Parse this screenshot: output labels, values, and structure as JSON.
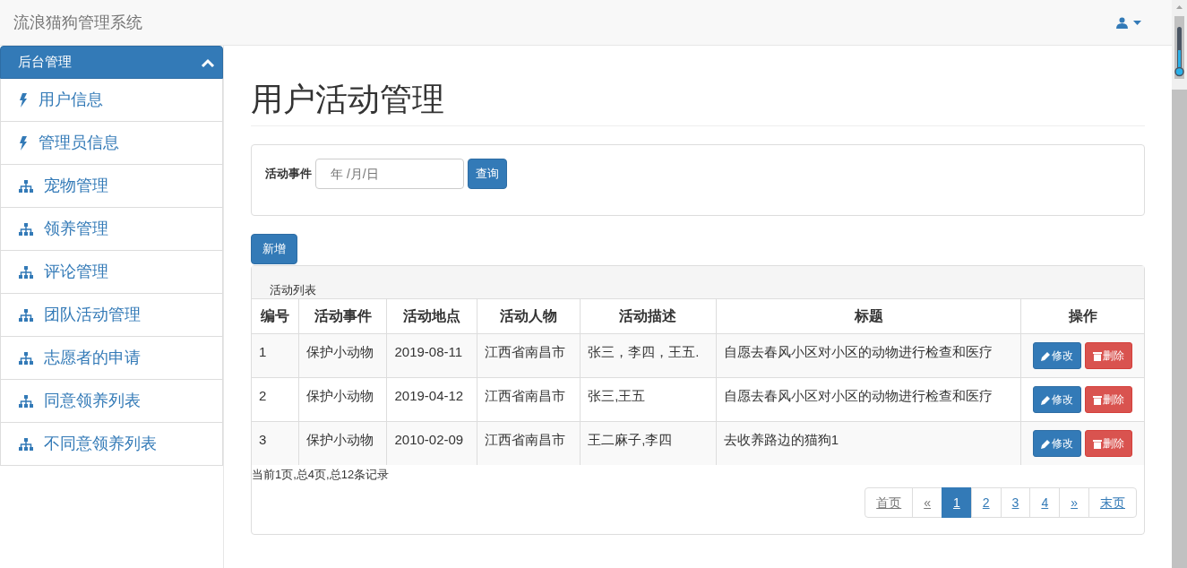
{
  "navbar": {
    "brand": "流浪猫狗管理系统"
  },
  "sidebar": {
    "title": "后台管理",
    "expanded": true,
    "items": [
      {
        "label": "用户信息",
        "kind": "bolt"
      },
      {
        "label": "管理员信息",
        "kind": "bolt"
      },
      {
        "label": "宠物管理",
        "kind": "tree"
      },
      {
        "label": "领养管理",
        "kind": "tree"
      },
      {
        "label": "评论管理",
        "kind": "tree"
      },
      {
        "label": "团队活动管理",
        "kind": "tree"
      },
      {
        "label": "志愿者的申请",
        "kind": "tree"
      },
      {
        "label": "同意领养列表",
        "kind": "tree"
      },
      {
        "label": "不同意领养列表",
        "kind": "tree"
      }
    ]
  },
  "page_title": "用户活动管理",
  "search": {
    "label": "活动事件",
    "placeholder": "年 /月/日",
    "button": "查询"
  },
  "add_button": "新增",
  "table": {
    "caption": "活动列表",
    "columns": [
      "编号",
      "活动事件",
      "活动地点",
      "活动人物",
      "活动描述",
      "标题",
      "操作"
    ],
    "rows": [
      {
        "cells": [
          "1",
          "保护小动物",
          "2019-08-11",
          "江西省南昌市",
          "张三，李四，王五.",
          "自愿去春风小区对小区的动物进行检查和医疗"
        ],
        "actions": [
          "修改",
          "删除"
        ]
      },
      {
        "cells": [
          "2",
          "保护小动物",
          "2019-04-12",
          "江西省南昌市",
          "张三,王五",
          "自愿去春风小区对小区的动物进行检查和医疗"
        ],
        "actions": [
          "修改",
          "删除"
        ]
      },
      {
        "cells": [
          "3",
          "保护小动物",
          "2010-02-09",
          "江西省南昌市",
          "王二麻子,李四",
          "去收养路边的猫狗1"
        ],
        "actions": [
          "修改",
          "删除"
        ]
      }
    ]
  },
  "summary": "当前1页,总4页,总12条记录",
  "pagination": [
    {
      "label": "首页",
      "selected": false,
      "disabled": true
    },
    {
      "label": "«",
      "selected": false,
      "disabled": true
    },
    {
      "label": "1",
      "selected": true,
      "disabled": false
    },
    {
      "label": "2",
      "selected": false,
      "disabled": false
    },
    {
      "label": "3",
      "selected": false,
      "disabled": false
    },
    {
      "label": "4",
      "selected": false,
      "disabled": false
    },
    {
      "label": "»",
      "selected": false,
      "disabled": false
    },
    {
      "label": "末页",
      "selected": false,
      "disabled": false
    }
  ]
}
